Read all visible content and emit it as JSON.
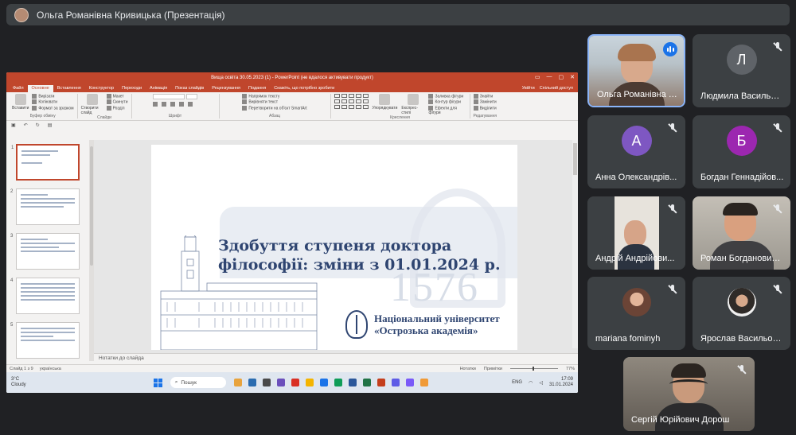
{
  "presenter_bar": {
    "title": "Ольга Романівна Кривицька (Презентація)"
  },
  "powerpoint": {
    "window_title": "Вища освіта 30.05.2023 (1) - PowerPoint (не вдалося активувати продукт)",
    "window_buttons": [
      "▭",
      "—",
      "▢",
      "✕"
    ],
    "tabs": [
      "Файл",
      "Основне",
      "Вставлення",
      "Конструктор",
      "Переходи",
      "Анімація",
      "Показ слайдів",
      "Рецензування",
      "Подання",
      "Скажіть, що потрібно зробити"
    ],
    "active_tab": "Основне",
    "tabs_right": [
      "Увійти",
      "Спільний доступ"
    ],
    "ribbon": {
      "clipboard": {
        "paste": "Вставити",
        "cut": "Вирізати",
        "copy": "Копіювати",
        "format": "Формат за зразком",
        "group": "Буфер обміну"
      },
      "slides": {
        "new": "Створити слайд",
        "layout": "Макет",
        "reset": "Скинути",
        "section": "Розділ",
        "group": "Слайди"
      },
      "font": {
        "group": "Шрифт"
      },
      "paragraph": {
        "direction": "Напрямок тексту",
        "align": "Вирівняти текст",
        "smartart": "Перетворити на об'єкт SmartArt",
        "group": "Абзац"
      },
      "drawing": {
        "arrange": "Упорядкувати",
        "styles": "Експрес-стилі",
        "fill": "Заливка фігури",
        "outline": "Контур фігури",
        "effects": "Ефекти для фігури",
        "group": "Креслення"
      },
      "editing": {
        "find": "Знайти",
        "replace": "Замінити",
        "select": "Виділити",
        "group": "Редагування"
      }
    },
    "thumbnails": [
      {
        "num": "1"
      },
      {
        "num": "2"
      },
      {
        "num": "3"
      },
      {
        "num": "4"
      },
      {
        "num": "5"
      }
    ],
    "slide": {
      "title_line1": "Здобуття ступеня доктора",
      "title_line2": "філософії: зміни з 01.01.2024 р.",
      "year": "1576",
      "university_line1": "Національний університет",
      "university_line2": "«Острозька академія»"
    },
    "notes_placeholder": "Нотатки до слайда",
    "status": {
      "slide_of": "Слайд 1 з 9",
      "language": "українська",
      "notes_btn": "Нотатки",
      "comments_btn": "Примітки",
      "zoom": "77%"
    }
  },
  "taskbar": {
    "weather_temp": "3°C",
    "weather_desc": "Cloudy",
    "search_label": "Пошук",
    "language": "ENG",
    "time": "17:09",
    "date": "31.01.2024",
    "app_colors": [
      "#e8a33d",
      "#2b6cb0",
      "#4a4a4a",
      "#6b4fbb",
      "#d93025",
      "#f4b400",
      "#1a73e8",
      "#0f9d58",
      "#2b579a",
      "#217346",
      "#c43e1c",
      "#5e5ce6",
      "#7a5af8",
      "#f09a37"
    ]
  },
  "participants": [
    {
      "name": "Ольга Романівна К...",
      "type": "video",
      "speaking": true
    },
    {
      "name": "Людмила Васильвна...",
      "type": "letter",
      "letter": "Л",
      "color": "#5f6368",
      "muted": true
    },
    {
      "name": "Анна Олександрів...",
      "type": "letter",
      "letter": "А",
      "color": "#7e57c2",
      "muted": true
    },
    {
      "name": "Богдан Геннадійов...",
      "type": "letter",
      "letter": "Б",
      "color": "#9c27b0",
      "muted": true
    },
    {
      "name": "Андрій Андрійови...",
      "type": "video",
      "muted": true
    },
    {
      "name": "Роман Богданович ...",
      "type": "video",
      "muted": true
    },
    {
      "name": "mariana fominyh",
      "type": "photo",
      "muted": true
    },
    {
      "name": "Ярослав Васильов...",
      "type": "photo",
      "muted": true
    },
    {
      "name": "Сергій Юрійович Дорош",
      "type": "video",
      "muted": true
    }
  ]
}
